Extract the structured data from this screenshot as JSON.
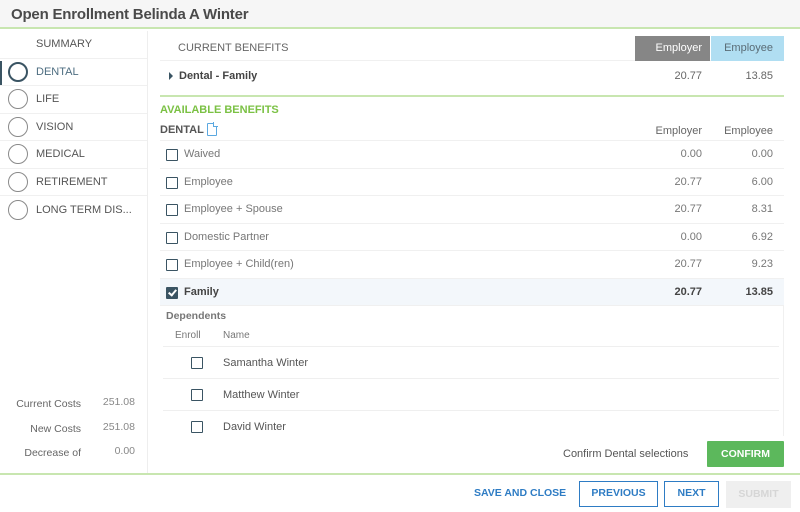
{
  "window": {
    "title": "Open Enrollment Belinda A Winter"
  },
  "sidebar": {
    "summary_label": "SUMMARY",
    "items": [
      {
        "label": "DENTAL",
        "active": true
      },
      {
        "label": "LIFE"
      },
      {
        "label": "VISION"
      },
      {
        "label": "MEDICAL"
      },
      {
        "label": "RETIREMENT"
      },
      {
        "label": "LONG TERM DIS..."
      }
    ],
    "costs": [
      {
        "label": "Current Costs",
        "value": "251.08"
      },
      {
        "label": "New Costs",
        "value": "251.08"
      },
      {
        "label": "Decrease of",
        "value": "0.00"
      }
    ]
  },
  "current_benefits": {
    "heading": "CURRENT BENEFITS",
    "employer_header": "Employer",
    "employee_header": "Employee",
    "row": {
      "name": "Dental - Family",
      "employer": "20.77",
      "employee": "13.85"
    }
  },
  "available_benefits": {
    "heading": "AVAILABLE BENEFITS",
    "plan_label": "DENTAL",
    "plan_icon": "document-icon",
    "employer_header": "Employer",
    "employee_header": "Employee",
    "options": [
      {
        "label": "Waived",
        "employer": "0.00",
        "employee": "0.00",
        "checked": false
      },
      {
        "label": "Employee",
        "employer": "20.77",
        "employee": "6.00",
        "checked": false
      },
      {
        "label": "Employee + Spouse",
        "employer": "20.77",
        "employee": "8.31",
        "checked": false
      },
      {
        "label": "Domestic Partner",
        "employer": "0.00",
        "employee": "6.92",
        "checked": false
      },
      {
        "label": "Employee + Child(ren)",
        "employer": "20.77",
        "employee": "9.23",
        "checked": false
      },
      {
        "label": "Family",
        "employer": "20.77",
        "employee": "13.85",
        "checked": true
      }
    ],
    "dependents": {
      "title": "Dependents",
      "enroll_header": "Enroll",
      "name_header": "Name",
      "rows": [
        {
          "name": "Samantha Winter",
          "enrolled": false
        },
        {
          "name": "Matthew Winter",
          "enrolled": false
        },
        {
          "name": "David Winter",
          "enrolled": false
        }
      ]
    },
    "confirm_text": "Confirm Dental selections",
    "confirm_label": "CONFIRM"
  },
  "footer": {
    "save_close_label": "SAVE AND CLOSE",
    "previous_label": "PREVIOUS",
    "next_label": "NEXT",
    "submit_label": "SUBMIT"
  },
  "colors": {
    "accent_green": "#7bc144",
    "confirm_green": "#5cb85c",
    "link_blue": "#2e7cc4",
    "employer_header_bg": "#868686",
    "employee_header_bg": "#b0def2",
    "nav_active": "#3a5463"
  }
}
